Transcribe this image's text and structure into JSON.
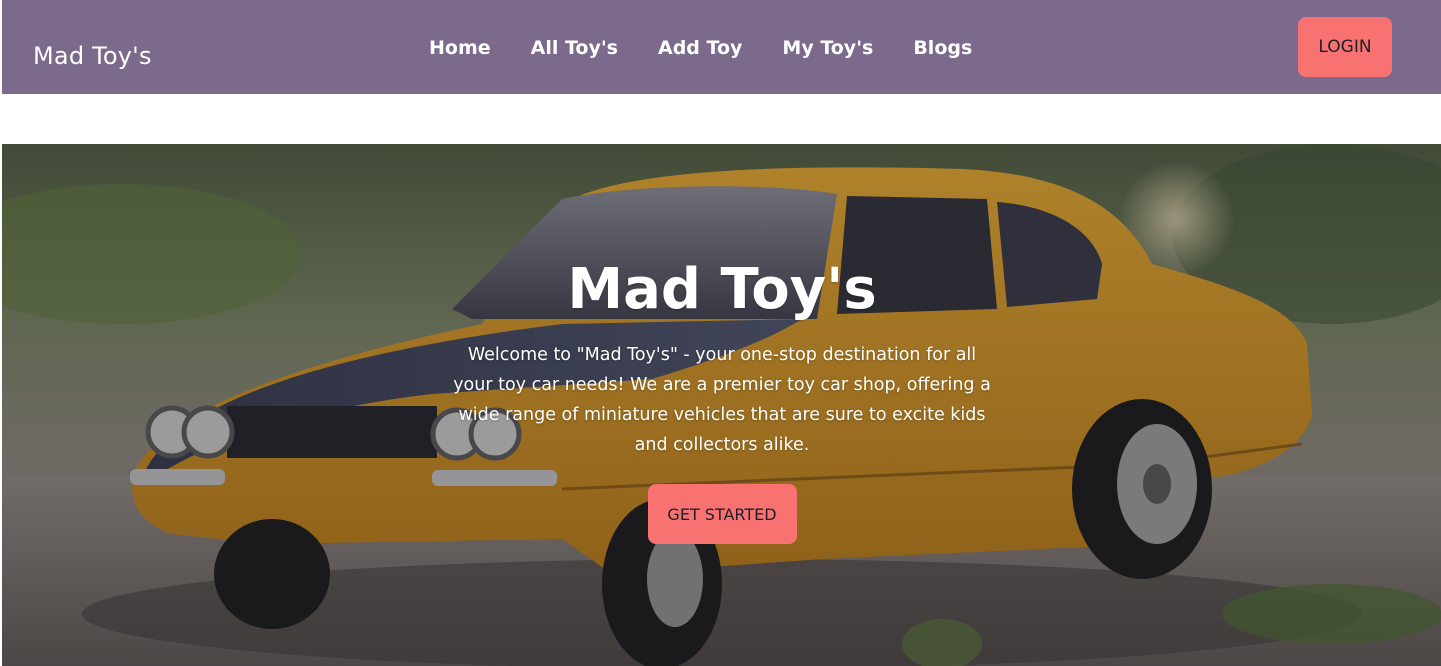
{
  "navbar": {
    "brand": "Mad Toy's",
    "links": [
      "Home",
      "All Toy's",
      "Add Toy",
      "My Toy's",
      "Blogs"
    ],
    "login_label": "LOGIN"
  },
  "hero": {
    "title": "Mad Toy's",
    "description": "Welcome to \"Mad Toy's\" - your one-stop destination for all your toy car needs! We are a premier toy car shop, offering a wide range of miniature vehicles that are sure to excite kids and collectors alike.",
    "cta_label": "GET STARTED"
  },
  "colors": {
    "navbar_bg": "#7b6a8c",
    "button_bg": "#f87272",
    "car_body": "#d89a1e",
    "car_hood": "#3a4256"
  }
}
